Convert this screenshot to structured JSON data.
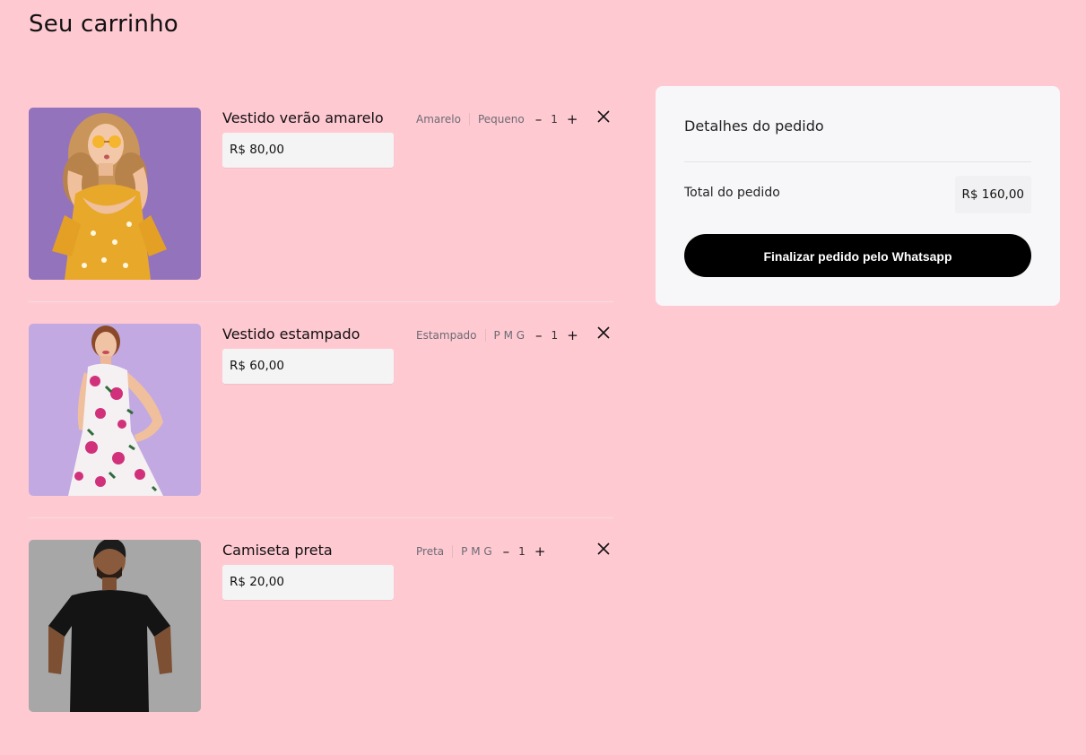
{
  "page": {
    "title": "Seu carrinho"
  },
  "cart": {
    "items": [
      {
        "name": "Vestido verão amarelo",
        "price": "R$ 80,00",
        "color": "Amarelo",
        "size": "Pequeno",
        "quantity": "1",
        "image": "woman-yellow-dress-photo"
      },
      {
        "name": "Vestido estampado",
        "price": "R$ 60,00",
        "color": "Estampado",
        "size": "P M G",
        "quantity": "1",
        "image": "woman-floral-dress-photo"
      },
      {
        "name": "Camiseta preta",
        "price": "R$ 20,00",
        "color": "Preta",
        "size": "P M G",
        "quantity": "1",
        "image": "man-black-tshirt-photo"
      }
    ],
    "icons": {
      "decrease": "minus-icon",
      "increase": "plus-icon",
      "remove": "close-icon"
    }
  },
  "summary": {
    "title": "Detalhes do pedido",
    "total_label": "Total do pedido",
    "total_value": "R$ 160,00",
    "checkout_label": "Finalizar pedido pelo Whatsapp"
  },
  "colors": {
    "background": "#ffc9d2",
    "card": "#f7f7fa",
    "button": "#000000",
    "button_text": "#ffffff"
  }
}
